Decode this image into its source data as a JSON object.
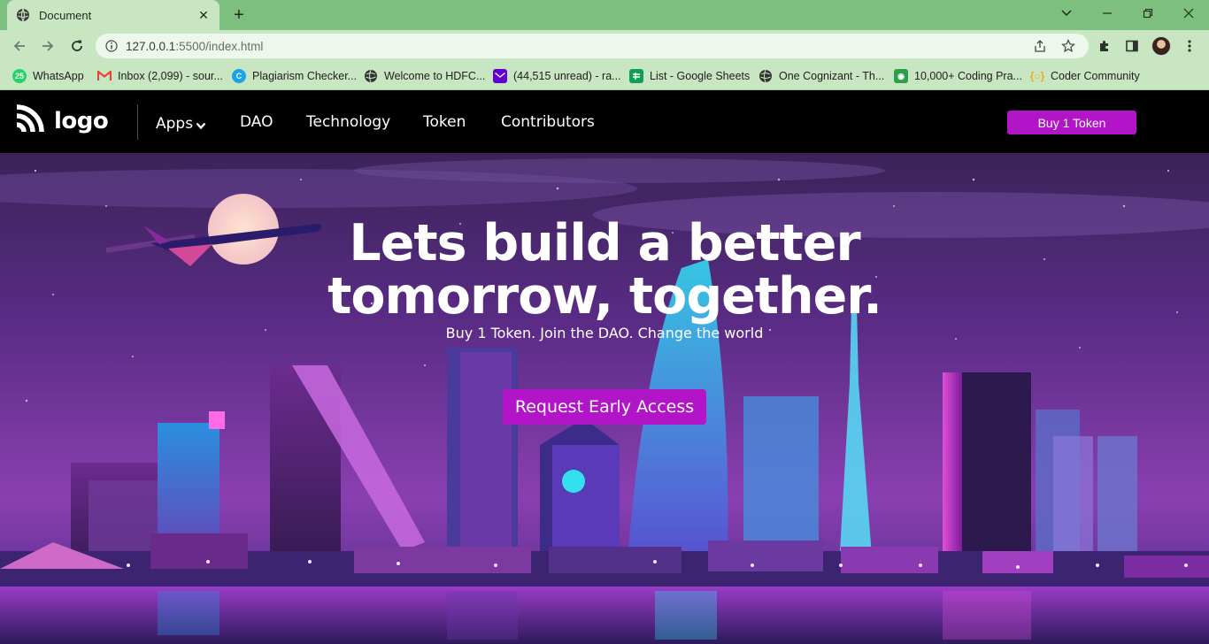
{
  "browser": {
    "tab_title": "Document",
    "url_host": "127.0.0.1",
    "url_rest": ":5500/index.html",
    "bookmarks": [
      {
        "label": "WhatsApp",
        "icon": "whatsapp-icon",
        "color": "#25d366"
      },
      {
        "label": "Inbox (2,099) - sour...",
        "icon": "gmail-icon",
        "color": "#ea4335"
      },
      {
        "label": "Plagiarism Checker...",
        "icon": "plagiarism-checker-icon",
        "color": "#1aa3e8"
      },
      {
        "label": "Welcome to HDFC...",
        "icon": "globe-icon",
        "color": "#333333"
      },
      {
        "label": "(44,515 unread) - ra...",
        "icon": "yahoo-mail-icon",
        "color": "#6001d2"
      },
      {
        "label": "List - Google Sheets",
        "icon": "google-sheets-icon",
        "color": "#0f9d58"
      },
      {
        "label": "One Cognizant - Th...",
        "icon": "globe-icon",
        "color": "#333333"
      },
      {
        "label": "10,000+ Coding Pra...",
        "icon": "coding-practice-icon",
        "color": "#2e9e4a"
      },
      {
        "label": "Coder Community",
        "icon": "coder-community-icon",
        "color": "#f5a623"
      }
    ]
  },
  "site": {
    "logo_text": "logo",
    "nav": {
      "apps": "Apps",
      "dao": "DAO",
      "technology": "Technology",
      "token": "Token",
      "contributors": "Contributors"
    },
    "buy_button": "Buy 1 Token",
    "accent_color": "#b214c8"
  },
  "hero": {
    "headline_line1": "Lets build a better",
    "headline_line2": "tomorrow, together.",
    "subline": "Buy 1 Token. Join the DAO. Change the world",
    "cta": "Request Early Access"
  }
}
